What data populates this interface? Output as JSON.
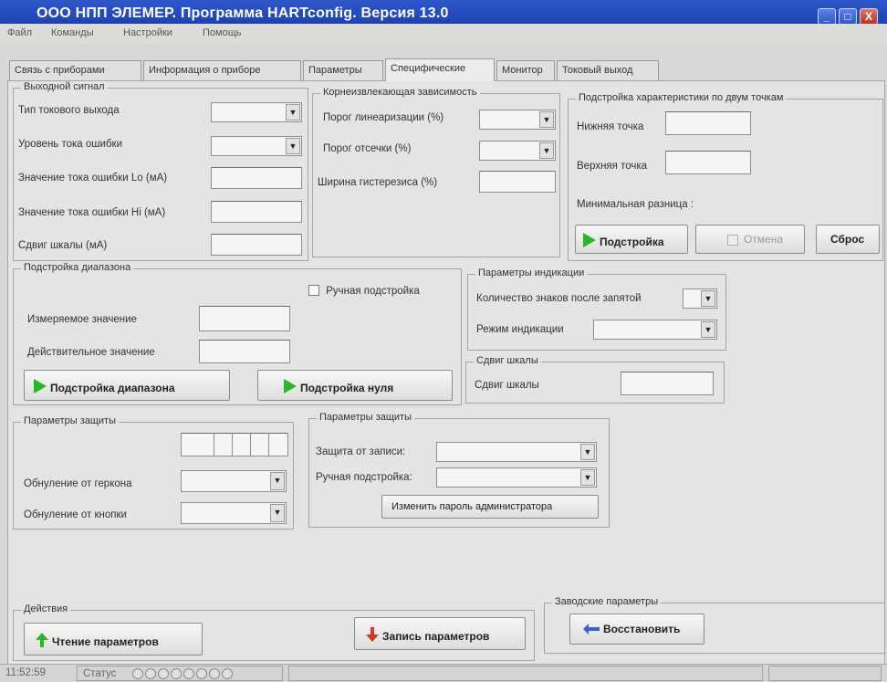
{
  "window": {
    "title": "ООО НПП ЭЛЕМЕР.  Программа HARTconfig.  Версия 13.0",
    "controls": [
      "_",
      "□",
      "X"
    ]
  },
  "menu": [
    "Файл",
    "Команды",
    "Настройки",
    "Помощь"
  ],
  "tabs": [
    {
      "label": "Связь с приборами",
      "active": false
    },
    {
      "label": "Информация о приборе",
      "active": false
    },
    {
      "label": "Параметры",
      "active": false
    },
    {
      "label": "Специфические",
      "active": true
    },
    {
      "label": "Монитор",
      "active": false
    },
    {
      "label": "Токовый выход",
      "active": false
    }
  ],
  "output_signal": {
    "legend": "Выходной сигнал",
    "current_type_label": "Тип токового выхода",
    "error_level_label": "Уровень тока ошибки",
    "error_lo_label": "Значение тока ошибки Lo (мА)",
    "error_hi_label": "Значение тока ошибки Hi (мА)",
    "scale_shift_label": "Сдвиг шкалы (мА)"
  },
  "sqrt": {
    "legend": "Корнеизвлекающая зависимость",
    "linear_threshold_label": "Порог линеаризации (%)",
    "cutoff_threshold_label": "Порог отсечки (%)",
    "hysteresis_label": "Ширина гистерезиса (%)"
  },
  "two_point": {
    "legend": "Подстройка характеристики по двум точкам",
    "low_point_label": "Нижняя точка",
    "high_point_label": "Верхняя точка",
    "min_diff_label": "Минимальная разница :",
    "adjust_button": "Подстройка",
    "cancel_button": "Отмена",
    "reset_button": "Сброс"
  },
  "range": {
    "legend": "Подстройка диапазона",
    "manual_label": "Ручная подстройка",
    "measured_label": "Измеряемое значение",
    "actual_label": "Действительное значение",
    "range_button": "Подстройка диапазона",
    "zero_button": "Подстройка нуля"
  },
  "display": {
    "legend": "Параметры индикации",
    "decimals_label": "Количество знаков после запятой",
    "mode_label": "Режим индикации"
  },
  "shift": {
    "legend": "Сдвиг шкалы",
    "label": "Сдвиг шкалы"
  },
  "protect1": {
    "legend": "Параметры защиты",
    "reed_label": "Обнуление от геркона",
    "button_label": "Обнуление от кнопки"
  },
  "protect2": {
    "legend": "Параметры защиты",
    "write_label": "Защита от записи:",
    "manual_label": "Ручная подстройка:",
    "password_button": "Изменить пароль администратора"
  },
  "actions": {
    "legend": "Действия",
    "read_button": "Чтение параметров",
    "write_button": "Запись параметров"
  },
  "factory": {
    "legend": "Заводские параметры",
    "restore_button": "Восстановить"
  },
  "status": {
    "time": "11:52:59",
    "status_label": "Статус"
  },
  "colors": {
    "green_arrow": "#2bb52b",
    "red_arrow": "#d23a2a",
    "blue_arrow": "#3a63c8",
    "titlebar": "#2146b8"
  }
}
